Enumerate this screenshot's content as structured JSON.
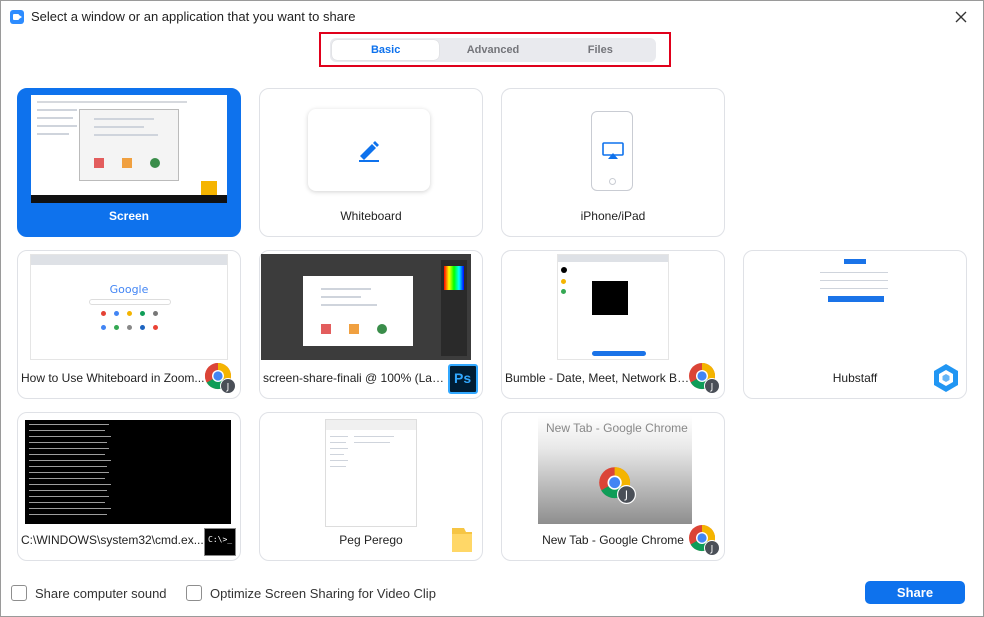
{
  "window": {
    "title": "Select a window or an application that you want to share",
    "close_icon": "close-icon"
  },
  "tabs": [
    {
      "label": "Basic",
      "active": true
    },
    {
      "label": "Advanced",
      "active": false
    },
    {
      "label": "Files",
      "active": false
    }
  ],
  "sources": [
    {
      "label": "Screen",
      "selected": true,
      "thumb": "screen"
    },
    {
      "label": "Whiteboard",
      "selected": false,
      "thumb": "whiteboard"
    },
    {
      "label": "iPhone/iPad",
      "selected": false,
      "thumb": "phone"
    },
    {
      "label": "How to Use Whiteboard in Zoom...",
      "app_icon": "chrome-icon",
      "app_badge_letter": "J"
    },
    {
      "label": "screen-share-finali @ 100% (Laye...",
      "app_icon": "photoshop-icon",
      "app_badge_text": "Ps"
    },
    {
      "label": "Bumble - Date, Meet, Network Be...",
      "app_icon": "chrome-icon",
      "app_badge_letter": "J"
    },
    {
      "label": "Hubstaff",
      "app_icon": "hubstaff-icon"
    },
    {
      "label": "C:\\WINDOWS\\system32\\cmd.ex...",
      "app_icon": "cmd-icon",
      "app_badge_text": "C:\\>_"
    },
    {
      "label": "Peg Perego",
      "app_icon": "folder-icon"
    },
    {
      "label": "New Tab - Google Chrome",
      "app_icon": "chrome-icon",
      "app_badge_letter": "J",
      "thumb_title": "New Tab - Google Chrome"
    }
  ],
  "thumb_text": {
    "google": "Google"
  },
  "footer": {
    "share_sound_label": "Share computer sound",
    "optimize_label": "Optimize Screen Sharing for Video Clip",
    "share_button": "Share"
  },
  "colors": {
    "accent": "#0e72ed",
    "highlight_border": "#e0001b"
  }
}
